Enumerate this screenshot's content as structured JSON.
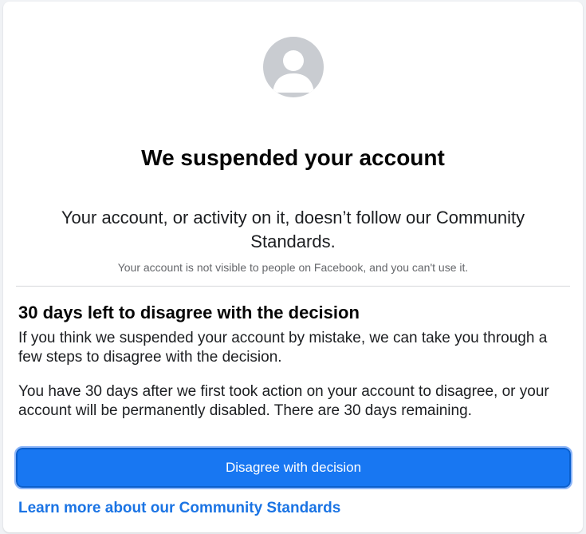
{
  "dialog": {
    "avatar_icon": "default-profile-avatar-icon",
    "title": "We suspended your account",
    "lead": "Your account, or activity on it, doesn’t follow our Community Standards.",
    "note": "Your account is not visible to people on Facebook, and you can't use it."
  },
  "appeal": {
    "heading": "30 days left to disagree with the decision",
    "paragraph_1": "If you think we suspended your account by mistake, we can take you through a few steps to disagree with the decision.",
    "paragraph_2": "You have 30 days after we first took action on your account to disagree, or your account will be permanently disabled. There are 30 days remaining.",
    "button_label": "Disagree with decision",
    "learn_more_label": "Learn more about our Community Standards"
  },
  "colors": {
    "primary": "#1877f2",
    "link": "#1b74e4",
    "avatar_bg": "#c9ccd1"
  }
}
